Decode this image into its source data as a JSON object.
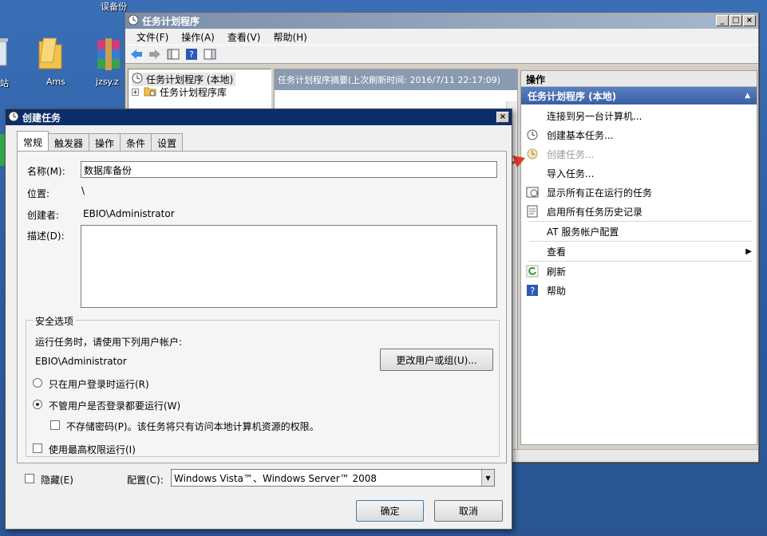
{
  "desktop": {
    "top_label": "误备份",
    "left_label": "站",
    "folder_label": "Ams",
    "rar_label": "jzsy.z"
  },
  "main_window": {
    "title": "任务计划程序",
    "menu": [
      "文件(F)",
      "操作(A)",
      "查看(V)",
      "帮助(H)"
    ],
    "tree": {
      "root": "任务计划程序 (本地)",
      "child": "任务计划程序库"
    },
    "summary_header": "任务计划程序摘要(上次刷新时间: 2016/7/11 22:17:09)"
  },
  "actions_pane": {
    "header": "操作",
    "section": "任务计划程序 (本地)",
    "items": [
      {
        "label": "连接到另一台计算机...",
        "icon": "none"
      },
      {
        "label": "创建基本任务...",
        "icon": "clock-wand-icon"
      },
      {
        "label": "创建任务...",
        "icon": "clock-task-icon",
        "disabled": true
      },
      {
        "label": "导入任务...",
        "icon": "none"
      },
      {
        "label": "显示所有正在运行的任务",
        "icon": "running-tasks-icon"
      },
      {
        "label": "启用所有任务历史记录",
        "icon": "history-icon"
      },
      {
        "label": "AT 服务帐户配置",
        "icon": "none"
      },
      {
        "label": "查看",
        "icon": "none",
        "submenu": true
      },
      {
        "label": "刷新",
        "icon": "refresh-icon"
      },
      {
        "label": "帮助",
        "icon": "help-icon"
      }
    ]
  },
  "dialog": {
    "title": "创建任务",
    "tabs": [
      "常规",
      "触发器",
      "操作",
      "条件",
      "设置"
    ],
    "name_label": "名称(M):",
    "name_value": "数据库备份",
    "location_label": "位置:",
    "location_value": "\\",
    "author_label": "创建者:",
    "author_value": "EBIO\\Administrator",
    "desc_label": "描述(D):",
    "security": {
      "title": "安全选项",
      "run_as_label": "运行任务时，请使用下列用户帐户:",
      "user": "EBIO\\Administrator",
      "change_button": "更改用户或组(U)...",
      "radio_logged_on": "只在用户登录时运行(R)",
      "radio_always": "不管用户是否登录都要运行(W)",
      "no_store_password": "不存储密码(P)。该任务将只有访问本地计算机资源的权限。",
      "highest_privileges": "使用最高权限运行(I)"
    },
    "hidden_label": "隐藏(E)",
    "config_label": "配置(C):",
    "config_value": "Windows Vista™、Windows Server™ 2008",
    "ok_button": "确定",
    "cancel_button": "取消"
  },
  "colors": {
    "desktop": "#2b5fa8",
    "active_title": "#0b2d6b",
    "action_section": "#3a5fa6",
    "arrow": "#e03a2a"
  }
}
